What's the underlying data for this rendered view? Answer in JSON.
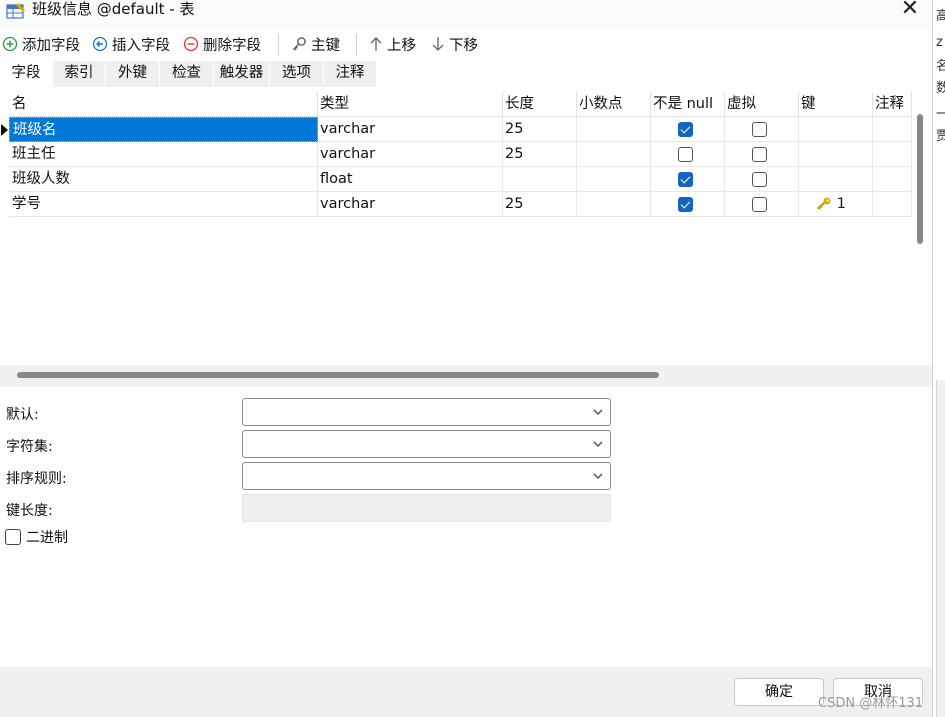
{
  "window": {
    "title": "班级信息 @default - 表",
    "close_symbol": "✕"
  },
  "toolbar": {
    "add_field": "添加字段",
    "insert_field": "插入字段",
    "delete_field": "删除字段",
    "primary_key": "主键",
    "move_up": "上移",
    "move_down": "下移"
  },
  "tabs": [
    {
      "label": "字段",
      "active": true
    },
    {
      "label": "索引"
    },
    {
      "label": "外键"
    },
    {
      "label": "检查"
    },
    {
      "label": "触发器"
    },
    {
      "label": "选项"
    },
    {
      "label": "注释"
    }
  ],
  "grid": {
    "columns": [
      "名",
      "类型",
      "长度",
      "小数点",
      "不是 null",
      "虚拟",
      "键",
      "注释"
    ],
    "rows": [
      {
        "name": "班级名",
        "type": "varchar",
        "length": "25",
        "decimal": "",
        "not_null": true,
        "virtual": false,
        "key": "",
        "comment": "",
        "selected": true
      },
      {
        "name": "班主任",
        "type": "varchar",
        "length": "25",
        "decimal": "",
        "not_null": false,
        "virtual": false,
        "key": "",
        "comment": ""
      },
      {
        "name": "班级人数",
        "type": "float",
        "length": "",
        "decimal": "",
        "not_null": true,
        "virtual": false,
        "key": "",
        "comment": ""
      },
      {
        "name": "学号",
        "type": "varchar",
        "length": "25",
        "decimal": "",
        "not_null": true,
        "virtual": false,
        "key": "1",
        "comment": ""
      }
    ]
  },
  "properties": {
    "default_label": "默认:",
    "default_value": "",
    "charset_label": "字符集:",
    "charset_value": "",
    "collation_label": "排序规则:",
    "collation_value": "",
    "key_length_label": "键长度:",
    "key_length_value": "",
    "binary_label": "二进制",
    "binary_checked": false
  },
  "footer": {
    "ok": "确定",
    "cancel": "取消",
    "watermark": "CSDN @林怀131"
  },
  "background_window_chars": [
    "高",
    "z",
    "名",
    "数",
    "一",
    "贾"
  ],
  "colors": {
    "selection": "#0078d7",
    "checkbox_checked": "#1565c0",
    "key_icon": "#e0a800",
    "add_icon": "#2e9b3c",
    "insert_icon": "#1f6fd1",
    "delete_icon": "#d9382f"
  }
}
